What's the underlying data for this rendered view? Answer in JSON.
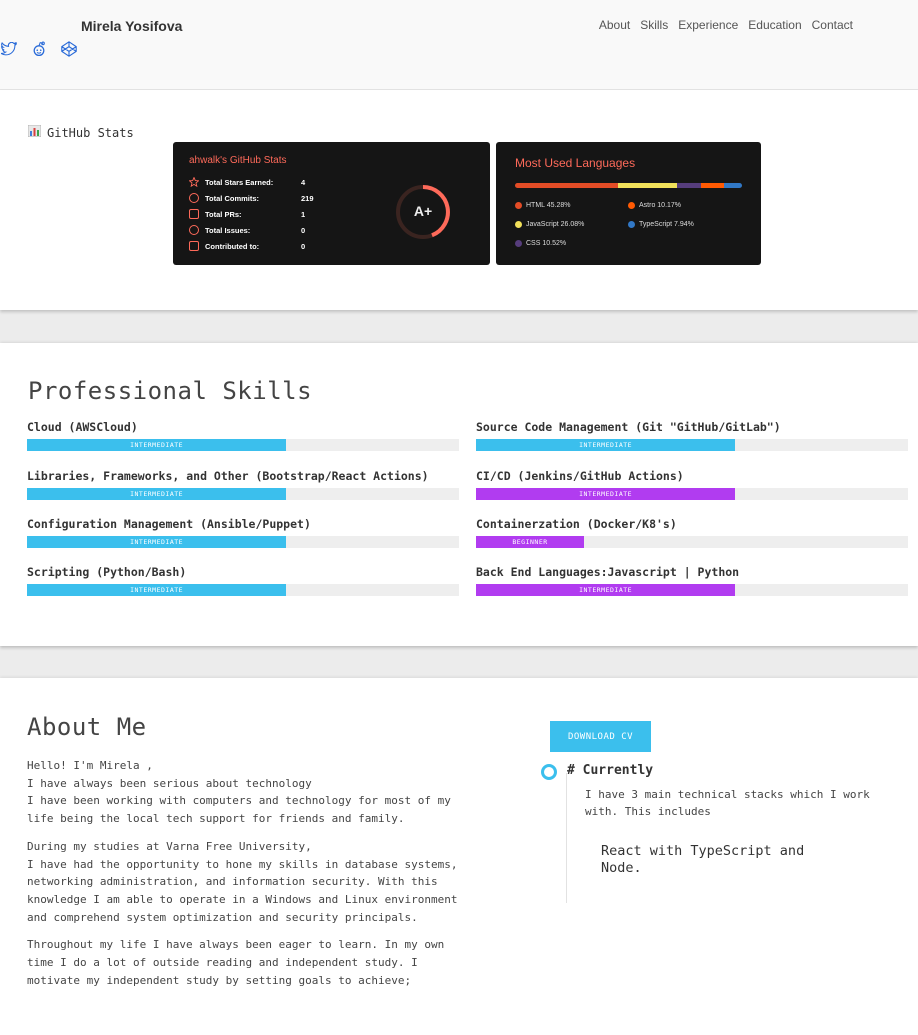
{
  "header": {
    "brand": "Mirela Yosifova",
    "nav": [
      "About",
      "Skills",
      "Experience",
      "Education",
      "Contact"
    ],
    "social_icons": [
      "twitter-icon",
      "reddit-icon",
      "codepen-icon"
    ]
  },
  "stats": {
    "label": "GitHub Stats",
    "card_title": "ahwalk's GitHub Stats",
    "rows": [
      {
        "label": "Total Stars Earned:",
        "value": "4"
      },
      {
        "label": "Total Commits:",
        "value": "219"
      },
      {
        "label": "Total PRs:",
        "value": "1"
      },
      {
        "label": "Total Issues:",
        "value": "0"
      },
      {
        "label": "Contributed to:",
        "value": "0"
      }
    ],
    "grade": "A+",
    "langs_title": "Most Used Languages",
    "languages": [
      {
        "name": "HTML 45.28%",
        "percent": 45.28,
        "color": "#e34c26"
      },
      {
        "name": "Astro 10.17%",
        "percent": 10.17,
        "color": "#ff5a03"
      },
      {
        "name": "JavaScript 26.08%",
        "percent": 26.08,
        "color": "#f1e05a"
      },
      {
        "name": "TypeScript 7.94%",
        "percent": 7.94,
        "color": "#3178c6"
      },
      {
        "name": "CSS 10.52%",
        "percent": 10.52,
        "color": "#563d7c"
      }
    ]
  },
  "skills": {
    "title": "Professional Skills",
    "left": [
      {
        "name": "Cloud (AWSCloud)",
        "level": "INTERMEDIATE",
        "fill": 0.6,
        "color": "#3bbfed"
      },
      {
        "name": "Libraries, Frameworks, and Other (Bootstrap/React Actions)",
        "level": "INTERMEDIATE",
        "fill": 0.6,
        "color": "#3bbfed"
      },
      {
        "name": "Configuration Management (Ansible/Puppet)",
        "level": "INTERMEDIATE",
        "fill": 0.6,
        "color": "#3bbfed"
      },
      {
        "name": "Scripting (Python/Bash)",
        "level": "INTERMEDIATE",
        "fill": 0.6,
        "color": "#3bbfed"
      }
    ],
    "right": [
      {
        "name": "Source Code Management (Git \"GitHub/GitLab\")",
        "level": "INTERMEDIATE",
        "fill": 0.6,
        "color": "#3bbfed"
      },
      {
        "name": "CI/CD (Jenkins/GitHub Actions)",
        "level": "INTERMEDIATE",
        "fill": 0.6,
        "color": "#b13cf0"
      },
      {
        "name": "Containerzation (Docker/K8's)",
        "level": "BEGINNER",
        "fill": 0.25,
        "color": "#b13cf0"
      },
      {
        "name": "Back End Languages:Javascript | Python",
        "level": "INTERMEDIATE",
        "fill": 0.6,
        "color": "#b13cf0"
      }
    ]
  },
  "about": {
    "title": "About Me",
    "paragraphs": [
      "Hello! I'm Mirela ,\nI have always been serious about technology\nI have been working with computers and technology for most of my life being the local tech support for friends and family.",
      "During my studies at Varna Free University,\nI have had the opportunity to hone my skills in database systems, networking administration, and information security. With this knowledge I am able to operate in a Windows and Linux environment and comprehend system optimization and security principals.",
      "Throughout my life I have always been eager to learn. In my own time I do a lot of outside reading and independent study. I motivate my independent study by setting goals to achieve;"
    ],
    "cv_button": "DOWNLOAD CV",
    "current_heading": "# Currently",
    "current_text": "I have 3 main technical stacks which I work with. This includes",
    "current_quote": "React with TypeScript and Node."
  }
}
